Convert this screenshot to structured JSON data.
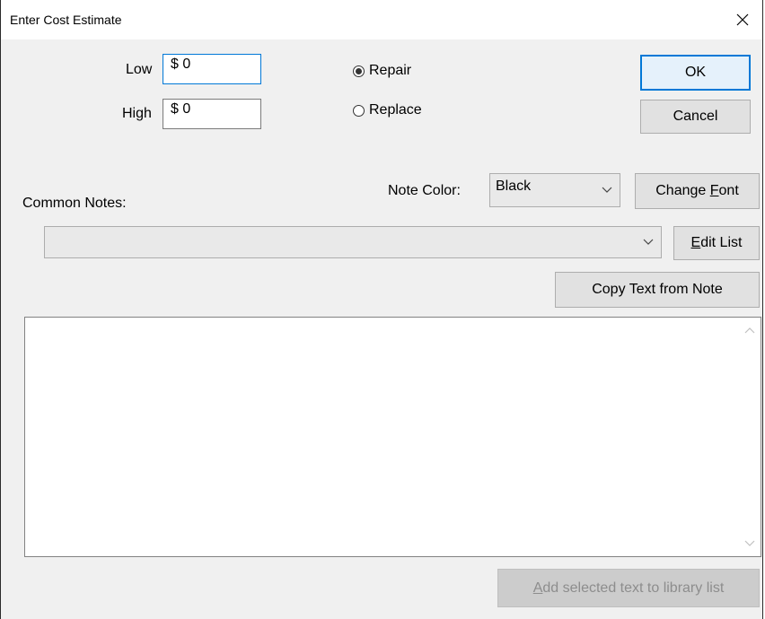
{
  "window": {
    "title": "Enter Cost Estimate",
    "close_symbol": "✕"
  },
  "estimate": {
    "low_label": "Low",
    "low_value": "$ 0",
    "high_label": "High",
    "high_value": "$ 0"
  },
  "action": {
    "options": [
      {
        "label": "Repair",
        "selected": true
      },
      {
        "label": "Replace",
        "selected": false
      }
    ]
  },
  "buttons": {
    "ok": "OK",
    "cancel": "Cancel",
    "change_font_pre": "Change ",
    "change_font_u": "F",
    "change_font_post": "ont",
    "edit_list_u": "E",
    "edit_list_post": "dit List",
    "copy_text": "Copy Text from Note",
    "add_selected_u": "A",
    "add_selected_post": "dd selected text to library list"
  },
  "note_color": {
    "label": "Note Color:",
    "value": "Black"
  },
  "common_notes": {
    "label": "Common Notes:",
    "value": ""
  },
  "notes_text": "",
  "colors": {
    "accent": "#0078d7",
    "dialog_bg": "#f0f0f0"
  }
}
